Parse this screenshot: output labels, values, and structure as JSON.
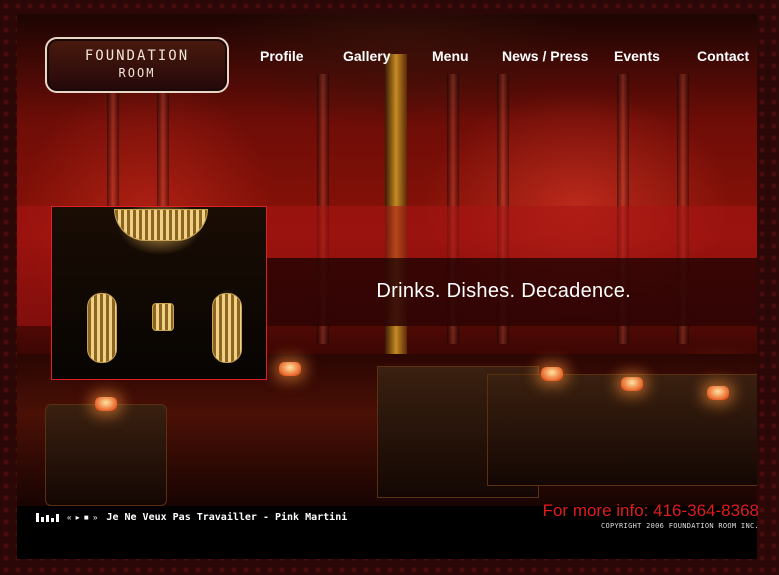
{
  "logo": {
    "line1": "FOUNDATION",
    "line2": "ROOM"
  },
  "nav": {
    "items": [
      {
        "label": "Profile"
      },
      {
        "label": "Gallery"
      },
      {
        "label": "Menu"
      },
      {
        "label": "News / Press"
      },
      {
        "label": "Events"
      },
      {
        "label": "Contact"
      }
    ]
  },
  "hero": {
    "tagline": "Drinks. Dishes. Decadence."
  },
  "player": {
    "controls": "« ▸ ■ »",
    "track": "Je Ne Veux Pas Travailler - Pink Martini"
  },
  "footer": {
    "info": "For more info: 416-364-8368",
    "copyright": "COPYRIGHT 2006 FOUNDATION ROOM INC."
  },
  "colors": {
    "accent": "#e21b1b",
    "background": "#000000",
    "frame": "#2b0707"
  }
}
